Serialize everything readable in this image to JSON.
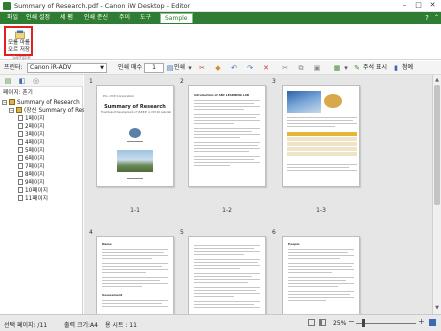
{
  "window": {
    "title": "Summary of Research.pdf - Canon iW Desktop - Editor"
  },
  "menu": {
    "items": [
      "파일",
      "인쇄 설정",
      "세 팸",
      "인쇄 준신",
      "주이",
      "도구",
      "Sample"
    ],
    "active_index": 6
  },
  "ribbon": {
    "button_label_line1": "모를 마를",
    "button_label_line2": "오르 저장",
    "group_label": "Sample"
  },
  "toolbar": {
    "printer_label": "프린터:",
    "printer_value": "Canon iR-ADV",
    "copies_label": "인쇄 매수",
    "copies_value": "1",
    "print_label": "인쇄",
    "comments_label": "주석 표시",
    "attach_label": "첨예"
  },
  "left_pane": {
    "header": "페이지: 혼기",
    "root": "Summary of Research",
    "child": "(장신 Summary of Resea",
    "pages": [
      "1페이지",
      "2페이지",
      "3페이지",
      "4페이지",
      "5페이지",
      "6페이지",
      "7페이지",
      "8페이지",
      "9페이지",
      "10페이지",
      "11페이지"
    ]
  },
  "pages": [
    {
      "number": "1",
      "label": "1-1"
    },
    {
      "number": "2",
      "label": "1-2"
    },
    {
      "number": "3",
      "label": "1-3"
    },
    {
      "number": "4",
      "label": ""
    },
    {
      "number": "5",
      "label": ""
    },
    {
      "number": "6",
      "label": ""
    }
  ],
  "page_content": {
    "p1_header": "Pro. XYZ Corporation",
    "p1_title": "Summary of Research",
    "p1_subtitle": "Final Report Development of '####' in XYZ 40 Laboratory",
    "p2_title": "Introduction of ABC LEARNING LAB",
    "p4_title": "Name",
    "p4_title2": "Assessment",
    "p6_title": "People"
  },
  "statusbar": {
    "left": "선택 페이지: /11",
    "middle": "출력 크기:A4",
    "sheets": "용 시트 : 11",
    "zoom": "25%"
  },
  "colors": {
    "accent_green": "#2e7d32",
    "highlight_red": "#e02020"
  }
}
